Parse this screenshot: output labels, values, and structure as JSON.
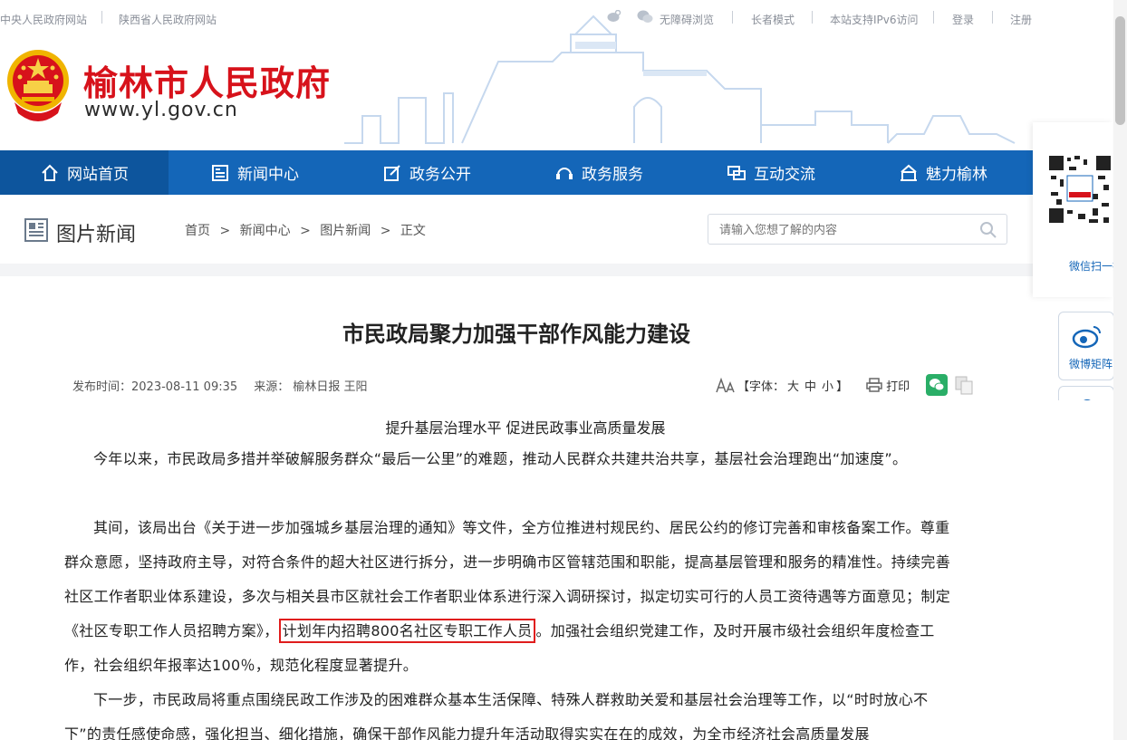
{
  "topbar": {
    "link_central": "中央人民政府网站",
    "link_province": "陕西省人民政府网站",
    "accessible": "无障碍浏览",
    "elder_mode": "长者模式",
    "ipv6": "本站支持IPv6访问",
    "login": "登录",
    "register": "注册"
  },
  "header": {
    "title": "榆林市人民政府",
    "url": "www.yl.gov.cn"
  },
  "nav": [
    {
      "label": "网站首页",
      "icon": "home-icon"
    },
    {
      "label": "新闻中心",
      "icon": "newspaper-icon"
    },
    {
      "label": "政务公开",
      "icon": "edit-icon"
    },
    {
      "label": "政务服务",
      "icon": "service-icon"
    },
    {
      "label": "互动交流",
      "icon": "chat-icon"
    },
    {
      "label": "魅力榆林",
      "icon": "landmark-icon"
    }
  ],
  "section": {
    "title": "图片新闻",
    "breadcrumb": [
      "首页",
      ">",
      "新闻中心",
      ">",
      "图片新闻",
      ">",
      "正文"
    ],
    "search_placeholder": "请输入您想了解的内容"
  },
  "article": {
    "title": "市民政局聚力加强干部作风能力建设",
    "publish_time": "发布时间：2023-08-11 09:35",
    "source": "来源： 榆林日报 王阳",
    "font_label": "【字体：",
    "font_large": "大",
    "font_medium": "中",
    "font_small": "小",
    "font_close": "】",
    "print": "打印",
    "subtitle": "提升基层治理水平 促进民政事业高质量发展",
    "p1": "今年以来，市民政局多措并举破解服务群众“最后一公里”的难题，推动人民群众共建共治共享，基层社会治理跑出“加速度”。",
    "p2_before": "其间，该局出台《关于进一步加强城乡基层治理的通知》等文件，全方位推进村规民约、居民公约的修订完善和审核备案工作。尊重群众意愿，坚持政府主导，对符合条件的超大社区进行拆分，进一步明确市区管辖范围和职能，提高基层管理和服务的精准性。持续完善社区工作者职业体系建设，多次与相关县市区就社会工作者职业体系进行深入调研探讨，拟定切实可行的人员工资待遇等方面意见；制定《社区专职工作人员招聘方案》，",
    "p2_highlight": "计划年内招聘800名社区专职工作人员",
    "p2_after": "。加强社会组织党建工作，及时开展市级社会组织年度检查工作，社会组织年报率达100％，规范化程度显著提升。",
    "p3": "下一步，市民政局将重点围绕民政工作涉及的困难群众基本生活保障、特殊人群救助关爱和基层社会治理等工作，以“时时放心不下”的责任感使命感，强化担当、细化措施，确保干部作风能力提升年活动取得实实在在的成效，为全市经济社会高质量发展"
  },
  "side": {
    "qr_caption": "微信扫一扫",
    "weibo_label": "微博矩阵"
  },
  "colors": {
    "nav_bg": "#1466b8",
    "title_red": "#d7121b",
    "highlight_border": "#e01c1c"
  }
}
